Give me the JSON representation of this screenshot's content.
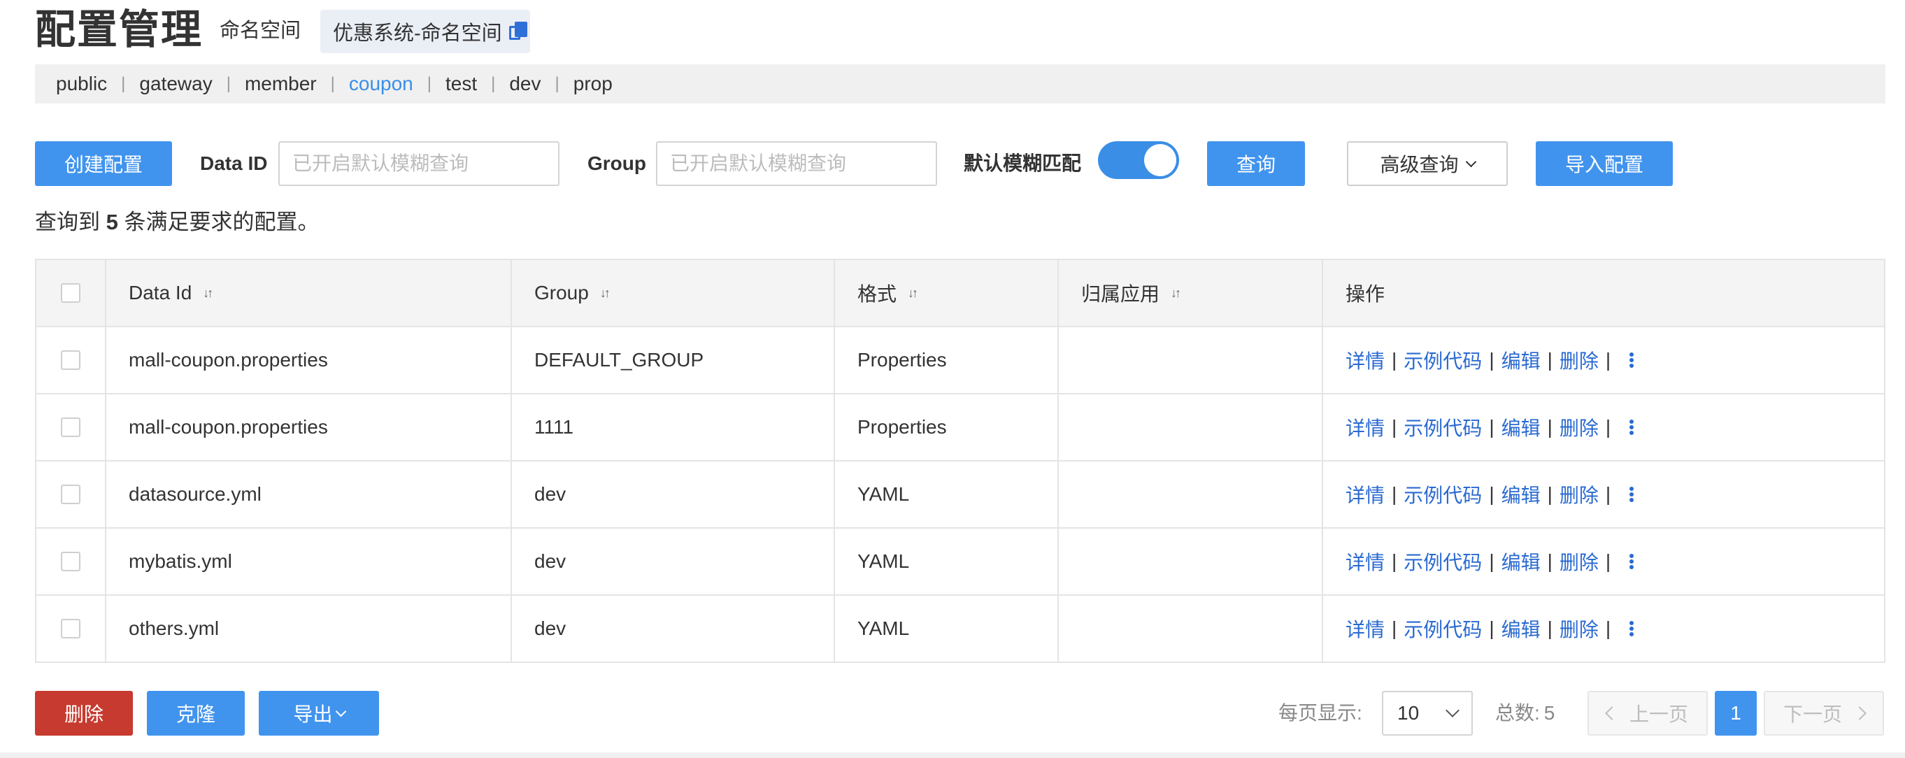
{
  "header": {
    "title": "配置管理",
    "namespace_label": "命名空间",
    "namespace_value": "优惠系统-命名空间"
  },
  "namespaces": [
    {
      "label": "public",
      "active": false
    },
    {
      "label": "gateway",
      "active": false
    },
    {
      "label": "member",
      "active": false
    },
    {
      "label": "coupon",
      "active": true
    },
    {
      "label": "test",
      "active": false
    },
    {
      "label": "dev",
      "active": false
    },
    {
      "label": "prop",
      "active": false
    }
  ],
  "toolbar": {
    "create_label": "创建配置",
    "dataid_label": "Data ID",
    "dataid_placeholder": "已开启默认模糊查询",
    "group_label": "Group",
    "group_placeholder": "已开启默认模糊查询",
    "fuzzy_label": "默认模糊匹配",
    "fuzzy_enabled": true,
    "query_label": "查询",
    "advanced_label": "高级查询",
    "import_label": "导入配置"
  },
  "result": {
    "prefix": "查询到",
    "count": "5",
    "suffix": "条满足要求的配置。"
  },
  "table": {
    "columns": [
      "Data Id",
      "Group",
      "格式",
      "归属应用",
      "操作"
    ],
    "rows": [
      {
        "data_id": "mall-coupon.properties",
        "group": "DEFAULT_GROUP",
        "format": "Properties",
        "app": ""
      },
      {
        "data_id": "mall-coupon.properties",
        "group": "1111",
        "format": "Properties",
        "app": ""
      },
      {
        "data_id": "datasource.yml",
        "group": "dev",
        "format": "YAML",
        "app": ""
      },
      {
        "data_id": "mybatis.yml",
        "group": "dev",
        "format": "YAML",
        "app": ""
      },
      {
        "data_id": "others.yml",
        "group": "dev",
        "format": "YAML",
        "app": ""
      }
    ],
    "actions": {
      "detail": "详情",
      "sample_code": "示例代码",
      "edit": "编辑",
      "delete": "删除",
      "separator": "|"
    }
  },
  "footer": {
    "delete_label": "删除",
    "clone_label": "克隆",
    "export_label": "导出",
    "per_page_label": "每页显示:",
    "per_page_value": "10",
    "total_label": "总数:",
    "total_value": "5",
    "prev_label": "上一页",
    "current_page": "1",
    "next_label": "下一页"
  },
  "colors": {
    "primary": "#4194ee",
    "danger": "#c63a2f",
    "link": "#2a6ad1",
    "active_namespace": "#3a8ee6"
  }
}
